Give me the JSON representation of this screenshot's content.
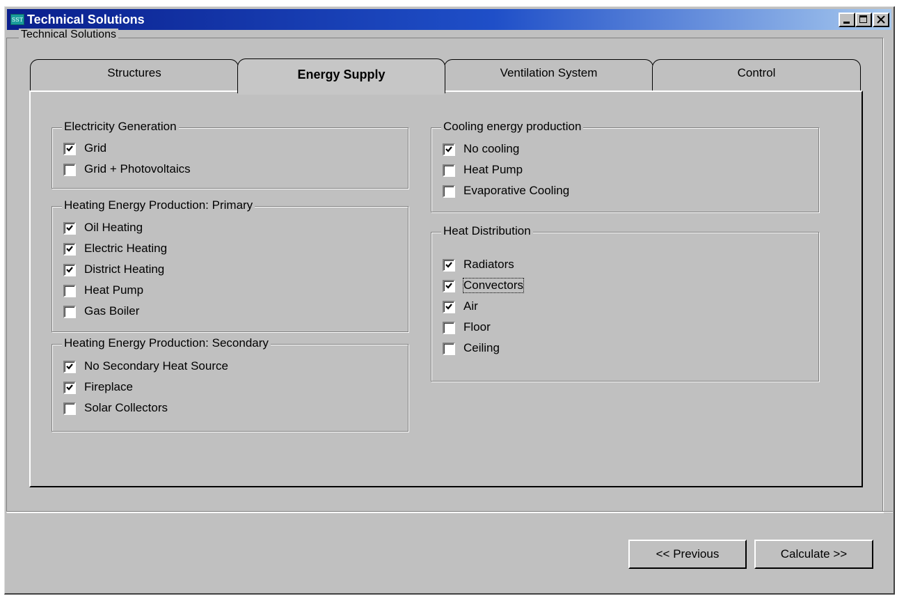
{
  "window": {
    "title": "Technical Solutions",
    "icon_text": "SST",
    "icon": "app-icon",
    "controls": [
      "minimize-icon",
      "maximize-icon",
      "close-icon"
    ]
  },
  "outer_group": {
    "label": "Technical Solutions"
  },
  "tabs": [
    {
      "label": "Structures",
      "active": false
    },
    {
      "label": "Energy Supply",
      "active": true
    },
    {
      "label": "Ventilation System",
      "active": false
    },
    {
      "label": "Control",
      "active": false
    }
  ],
  "groups": {
    "electricity": {
      "label": "Electricity Generation",
      "options": [
        {
          "label": "Grid",
          "checked": true
        },
        {
          "label": "Grid + Photovoltaics",
          "checked": false
        }
      ]
    },
    "heating_primary": {
      "label": "Heating Energy Production: Primary",
      "options": [
        {
          "label": "Oil Heating",
          "checked": true
        },
        {
          "label": "Electric Heating",
          "checked": true
        },
        {
          "label": "District Heating",
          "checked": true
        },
        {
          "label": "Heat Pump",
          "checked": false
        },
        {
          "label": "Gas Boiler",
          "checked": false
        }
      ]
    },
    "heating_secondary": {
      "label": "Heating Energy Production: Secondary",
      "options": [
        {
          "label": "No Secondary Heat Source",
          "checked": true
        },
        {
          "label": "Fireplace",
          "checked": true
        },
        {
          "label": "Solar Collectors",
          "checked": false
        }
      ]
    },
    "cooling": {
      "label": "Cooling energy production",
      "options": [
        {
          "label": "No cooling",
          "checked": true
        },
        {
          "label": "Heat Pump",
          "checked": false
        },
        {
          "label": "Evaporative Cooling",
          "checked": false
        }
      ]
    },
    "distribution": {
      "label": "Heat Distribution",
      "options": [
        {
          "label": "Radiators",
          "checked": true
        },
        {
          "label": "Convectors",
          "checked": true,
          "focused": true
        },
        {
          "label": "Air",
          "checked": true
        },
        {
          "label": "Floor",
          "checked": false
        },
        {
          "label": "Ceiling",
          "checked": false
        }
      ]
    }
  },
  "buttons": {
    "previous": "<< Previous",
    "calculate": "Calculate >>"
  },
  "colors": {
    "face": "#c0c0c0",
    "title_start": "#0a1f8c",
    "title_end": "#a6c8ee"
  }
}
